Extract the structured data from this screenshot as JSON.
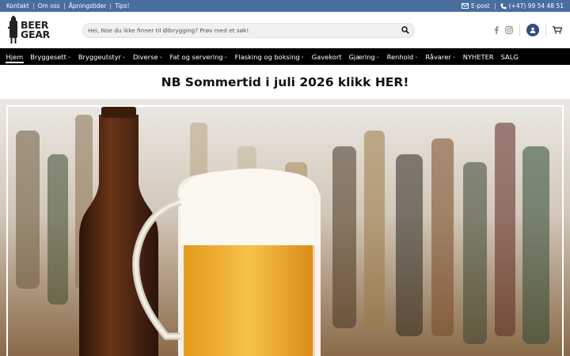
{
  "topbar": {
    "links": [
      "Kontakt",
      "Om oss",
      "Åpningstider",
      "Tips!"
    ],
    "email_label": "E-post",
    "phone_label": "(+47) 99 54 48 51"
  },
  "logo": {
    "line1": "BEER",
    "line2": "GEAR"
  },
  "search": {
    "placeholder": "Hei, Noe du ikke finner til Ølbrygging? Prøv med et søk!"
  },
  "nav": {
    "items": [
      {
        "label": "Hjem"
      },
      {
        "label": "Bryggesett"
      },
      {
        "label": "Bryggeutstyr"
      },
      {
        "label": "Diverse"
      },
      {
        "label": "Fat og servering"
      },
      {
        "label": "Flasking og boksing"
      },
      {
        "label": "Gavekort"
      },
      {
        "label": "Gjæring"
      },
      {
        "label": "Renhold"
      },
      {
        "label": "Råvarer"
      },
      {
        "label": "NYHETER"
      },
      {
        "label": "SALG"
      }
    ]
  },
  "promo": {
    "text": "NB Sommertid i juli 2026 klikk HER!"
  },
  "colors": {
    "topbar": "#4a6da0",
    "nav": "#000000",
    "account": "#33497a"
  }
}
